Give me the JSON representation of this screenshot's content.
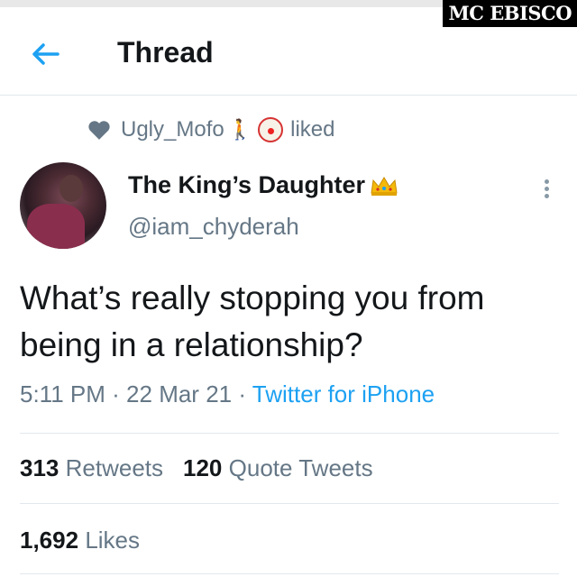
{
  "watermark": "MC EBISCO",
  "header": {
    "title": "Thread"
  },
  "social_context": {
    "user": "Ugly_Mofo",
    "emojis": "🚶‍♂️🤡",
    "action": "liked"
  },
  "author": {
    "name": "The King’s Daughter",
    "handle": "@iam_chyderah",
    "name_emoji": "👑"
  },
  "tweet": {
    "text": "What’s really stopping you from being in a relationship?",
    "time": "5:11 PM",
    "date": "22 Mar 21",
    "separator": "·",
    "source": "Twitter for iPhone"
  },
  "stats": {
    "retweets_count": "313",
    "retweets_label": "Retweets",
    "quotes_count": "120",
    "quotes_label": "Quote Tweets",
    "likes_count": "1,692",
    "likes_label": "Likes"
  },
  "colors": {
    "accent": "#1da1f2",
    "muted": "#657786",
    "text": "#14171a",
    "divider": "#e1e8ed"
  }
}
